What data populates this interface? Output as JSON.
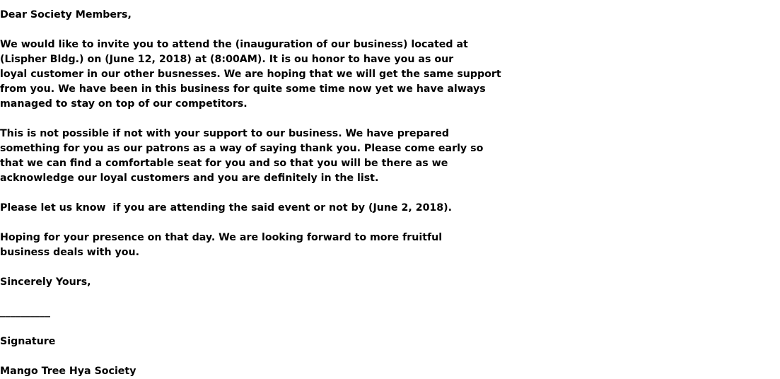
{
  "letter": {
    "salutation": "Dear Society Members,",
    "paragraph1": [
      "We would like to invite you to attend the (inauguration of our business) located at",
      "(Lispher Bldg.) on (June 12, 2018) at (8:00AM). It is ou honor to have you as our",
      "loyal customer in our other busnesses. We are hoping that we will get the same support",
      "from you. We have been in this business for quite some time now yet we have always",
      "managed to stay on top of our competitors."
    ],
    "paragraph2": [
      "This is not possible if not with your support to our business. We have prepared",
      "something for you as our patrons as a way of saying thank you. Please come early so",
      "that we can find a comfortable seat for you and so that you will be there as we",
      "acknowledge our loyal customers and you are definitely in the list."
    ],
    "paragraph3": [
      "Please let us know  if you are attending the said event or not by (June 2, 2018)."
    ],
    "paragraph4": [
      "Hoping for your presence on that day. We are looking forward to more fruitful",
      "business deals with you."
    ],
    "closing": "Sincerely Yours,",
    "signature_line": "__________",
    "signature_label": "Signature",
    "organization": "Mango Tree Hya Society"
  }
}
